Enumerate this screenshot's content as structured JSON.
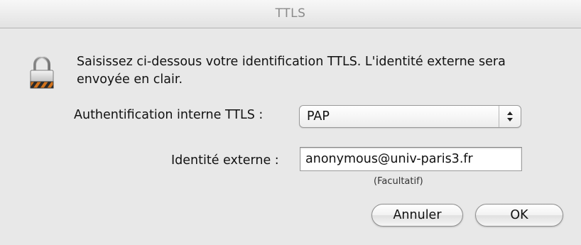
{
  "window": {
    "title": "TTLS"
  },
  "dialog": {
    "icon": "lock-icon",
    "message": "Saisissez ci-dessous votre identification TTLS. L'identité externe sera envoyée en clair.",
    "inner_auth_label": "Authentification interne TTLS :",
    "inner_auth_value": "PAP",
    "external_identity_label": "Identité externe :",
    "external_identity_value": "anonymous@univ-paris3.fr",
    "external_identity_hint": "(Facultatif)"
  },
  "buttons": {
    "cancel_label": "Annuler",
    "ok_label": "OK"
  }
}
